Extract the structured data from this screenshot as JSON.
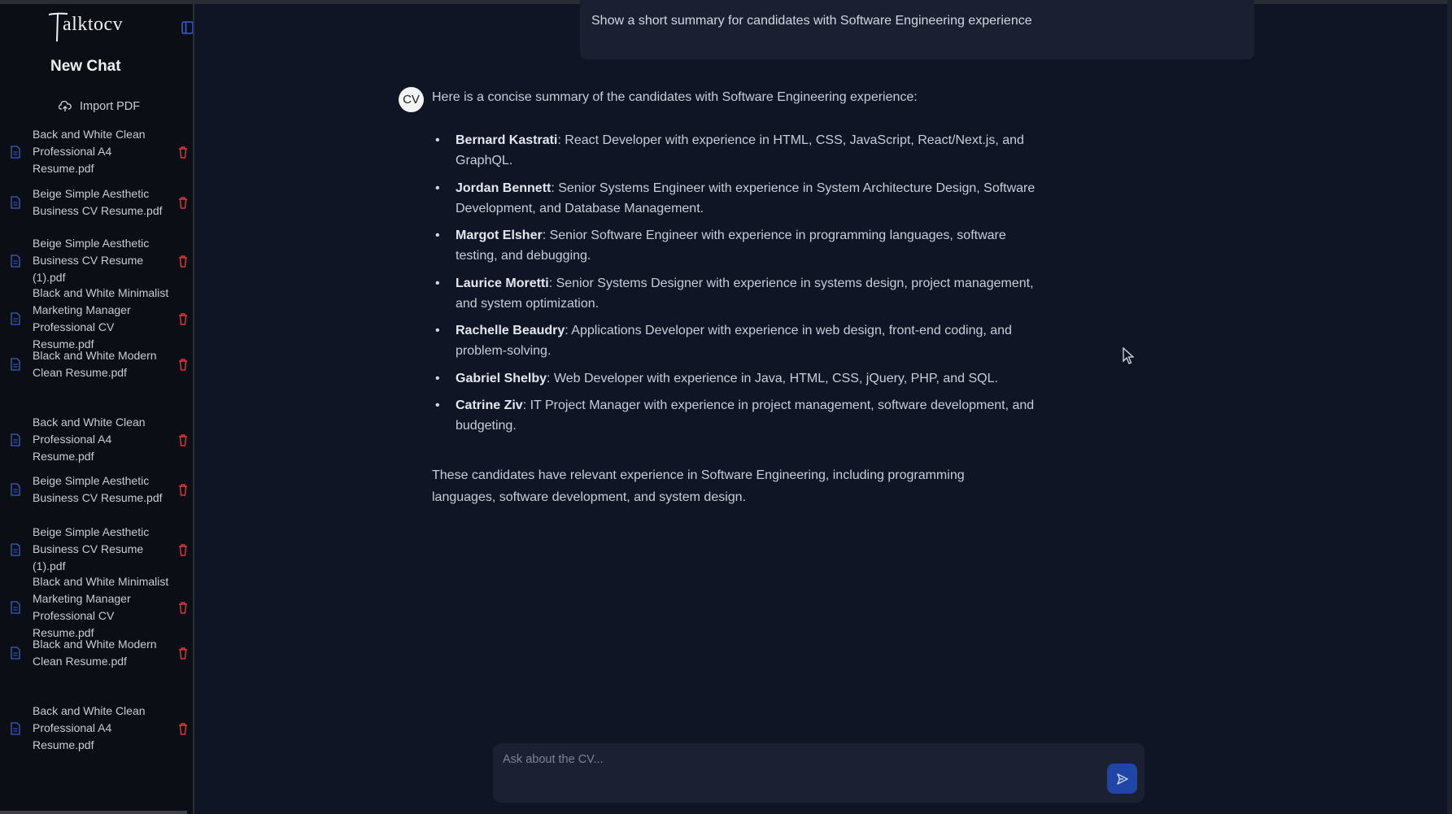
{
  "app": {
    "logo_text": "alktocv",
    "new_chat_label": "New Chat",
    "import_label": "Import PDF",
    "icons": {
      "logo": "taktocv-logo",
      "toggle": "sidebar-toggle-icon",
      "import": "upload-icon",
      "file": "document-icon",
      "delete": "trash-icon",
      "send": "send-icon"
    },
    "colors": {
      "background": "#0f1525",
      "sidebar": "#0b0e14",
      "delete": "#d9393c",
      "file_icon": "#3b5fc4",
      "send": "#1f45a6"
    }
  },
  "files": [
    {
      "name": "Back and White Clean Professional A4 Resume.pdf"
    },
    {
      "name": "Beige Simple Aesthetic Business CV Resume.pdf"
    },
    {
      "name": "Beige Simple Aesthetic Business CV Resume (1).pdf"
    },
    {
      "name": "Black and White Minimalist Marketing Manager Professional CV Resume.pdf"
    },
    {
      "name": "Black and White Modern Clean Resume.pdf"
    },
    {
      "name": "Back and White Clean Professional A4 Resume.pdf"
    },
    {
      "name": "Beige Simple Aesthetic Business CV Resume.pdf"
    },
    {
      "name": "Beige Simple Aesthetic Business CV Resume (1).pdf"
    },
    {
      "name": "Black and White Minimalist Marketing Manager Professional CV Resume.pdf"
    },
    {
      "name": "Black and White Modern Clean Resume.pdf"
    },
    {
      "name": "Back and White Clean Professional A4 Resume.pdf"
    }
  ],
  "chat": {
    "user_message": "Show a short summary for candidates with Software Engineering experience",
    "assistant_avatar": "CV",
    "intro": "Here is a concise summary of the candidates with Software Engineering experience:",
    "candidates": [
      {
        "name": "Bernard Kastrati",
        "desc": ": React Developer with experience in HTML, CSS, JavaScript, React/Next.js, and GraphQL."
      },
      {
        "name": "Jordan Bennett",
        "desc": ": Senior Systems Engineer with experience in System Architecture Design, Software Development, and Database Management."
      },
      {
        "name": "Margot Elsher",
        "desc": ": Senior Software Engineer with experience in programming languages, software testing, and debugging."
      },
      {
        "name": "Laurice Moretti",
        "desc": ": Senior Systems Designer with experience in systems design, project management, and system optimization."
      },
      {
        "name": "Rachelle Beaudry",
        "desc": ": Applications Developer with experience in web design, front-end coding, and problem-solving."
      },
      {
        "name": "Gabriel Shelby",
        "desc": ": Web Developer with experience in Java, HTML, CSS, jQuery, PHP, and SQL."
      },
      {
        "name": "Catrine Ziv",
        "desc": ": IT Project Manager with experience in project management, software development, and budgeting."
      }
    ],
    "outro": "These candidates have relevant experience in Software Engineering, including programming languages, software development, and system design."
  },
  "input": {
    "placeholder": "Ask about the CV...",
    "value": ""
  }
}
